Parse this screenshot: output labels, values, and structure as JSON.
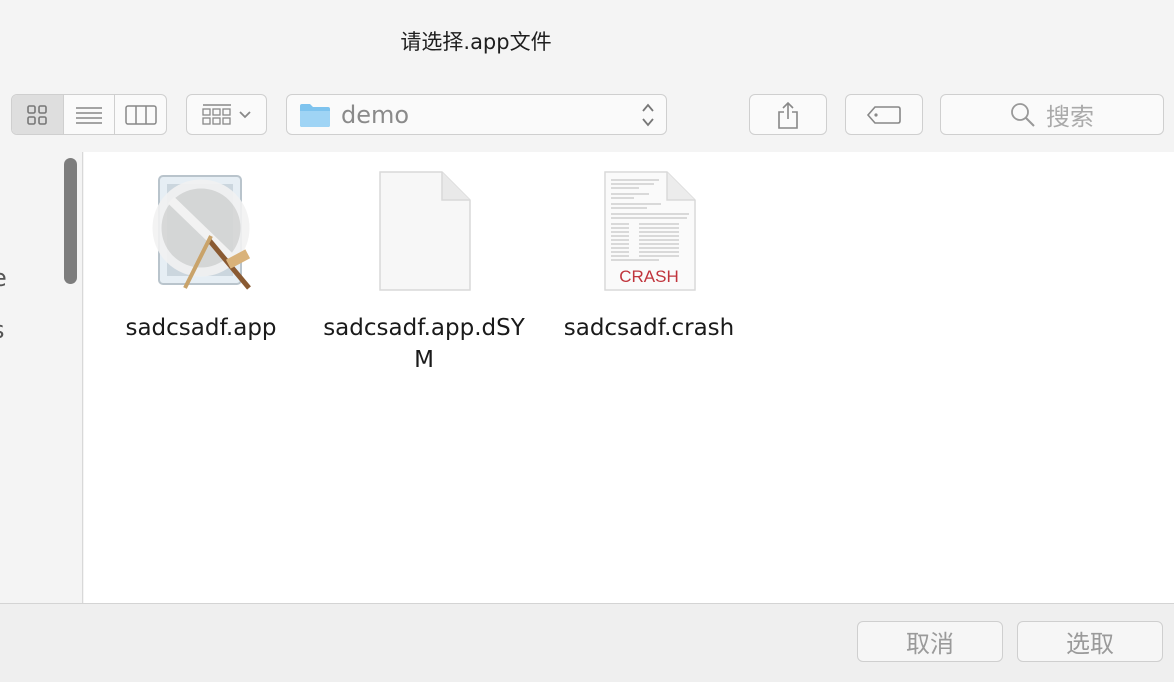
{
  "dialog": {
    "title": "请选择.app文件"
  },
  "toolbar": {
    "view_modes": [
      "icon-view",
      "list-view",
      "column-view"
    ],
    "active_view": "icon-view",
    "path_label": "demo",
    "search_placeholder": "搜索"
  },
  "sidebar": {
    "partial_items": [
      "e",
      "s"
    ]
  },
  "files": [
    {
      "name": "sadcsadf.app",
      "icon": "app-icon"
    },
    {
      "name": "sadcsadf.app.dSYM",
      "icon": "blank-document-icon"
    },
    {
      "name": "sadcsadf.crash",
      "icon": "crash-report-icon",
      "badge": "CRASH"
    }
  ],
  "footer": {
    "cancel_label": "取消",
    "choose_label": "选取"
  },
  "colors": {
    "folder": "#7ec3ee",
    "crash_red": "#c0343c",
    "scroll_thumb": "#7d7d7d"
  }
}
